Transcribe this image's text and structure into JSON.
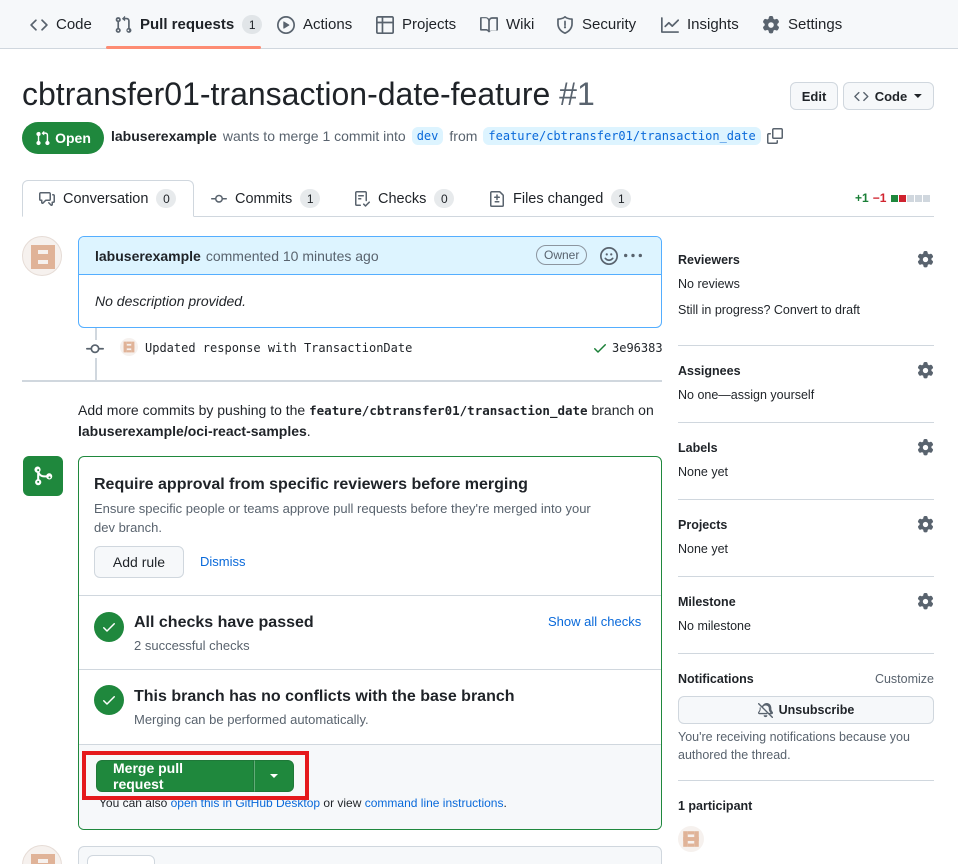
{
  "nav": {
    "items": [
      {
        "label": "Code",
        "icon": "code-icon"
      },
      {
        "label": "Pull requests",
        "icon": "pull-request-icon",
        "count": "1"
      },
      {
        "label": "Actions",
        "icon": "play-icon"
      },
      {
        "label": "Projects",
        "icon": "table-icon"
      },
      {
        "label": "Wiki",
        "icon": "book-icon"
      },
      {
        "label": "Security",
        "icon": "shield-icon"
      },
      {
        "label": "Insights",
        "icon": "graph-icon"
      },
      {
        "label": "Settings",
        "icon": "gear-icon"
      }
    ]
  },
  "header": {
    "title": "cbtransfer01-transaction-date-feature",
    "number": "#1",
    "edit_label": "Edit",
    "code_label": "Code",
    "state": "Open",
    "author": "labuserexample",
    "merge_text": "wants to merge 1 commit into",
    "base_branch": "dev",
    "from_text": "from",
    "head_branch": "feature/cbtransfer01/transaction_date"
  },
  "tabs": [
    {
      "label": "Conversation",
      "count": "0"
    },
    {
      "label": "Commits",
      "count": "1"
    },
    {
      "label": "Checks",
      "count": "0"
    },
    {
      "label": "Files changed",
      "count": "1"
    }
  ],
  "diffstat": {
    "additions": "+1",
    "deletions": "−1"
  },
  "comment": {
    "author": "labuserexample",
    "action": "commented 10 minutes ago",
    "badge": "Owner",
    "body": "No description provided."
  },
  "commit": {
    "message": "Updated response with TransactionDate",
    "sha": "3e96383"
  },
  "push_note": {
    "prefix": "Add more commits by pushing to the",
    "branch": "feature/cbtransfer01/transaction_date",
    "middle": "branch on",
    "repo": "labuserexample/oci-react-samples",
    "suffix": "."
  },
  "mergebox": {
    "approval_title": "Require approval from specific reviewers before merging",
    "approval_desc": "Ensure specific people or teams approve pull requests before they're merged into your dev branch.",
    "add_rule": "Add rule",
    "dismiss": "Dismiss",
    "checks_title": "All checks have passed",
    "checks_sub": "2 successful checks",
    "show_checks": "Show all checks",
    "conflicts_title": "This branch has no conflicts with the base branch",
    "conflicts_sub": "Merging can be performed automatically.",
    "merge_button": "Merge pull request",
    "also_prefix": "You can also",
    "desktop_link": "open this in GitHub Desktop",
    "or_view": "or view",
    "cli_link": "command line instructions",
    "also_suffix": "."
  },
  "sidebar": {
    "reviewers": {
      "title": "Reviewers",
      "value": "No reviews",
      "extra": "Still in progress? Convert to draft"
    },
    "assignees": {
      "title": "Assignees",
      "value": "No one—assign yourself"
    },
    "labels": {
      "title": "Labels",
      "value": "None yet"
    },
    "projects": {
      "title": "Projects",
      "value": "None yet"
    },
    "milestone": {
      "title": "Milestone",
      "value": "No milestone"
    },
    "notifications": {
      "title": "Notifications",
      "customize": "Customize",
      "button": "Unsubscribe",
      "note": "You're receiving notifications because you authored the thread."
    },
    "participants": {
      "title": "1 participant"
    }
  },
  "colors": {
    "accent_green": "#1f883d",
    "link_blue": "#0969da",
    "highlight_red": "#e5191d",
    "nav_underline": "#fd8c73"
  }
}
